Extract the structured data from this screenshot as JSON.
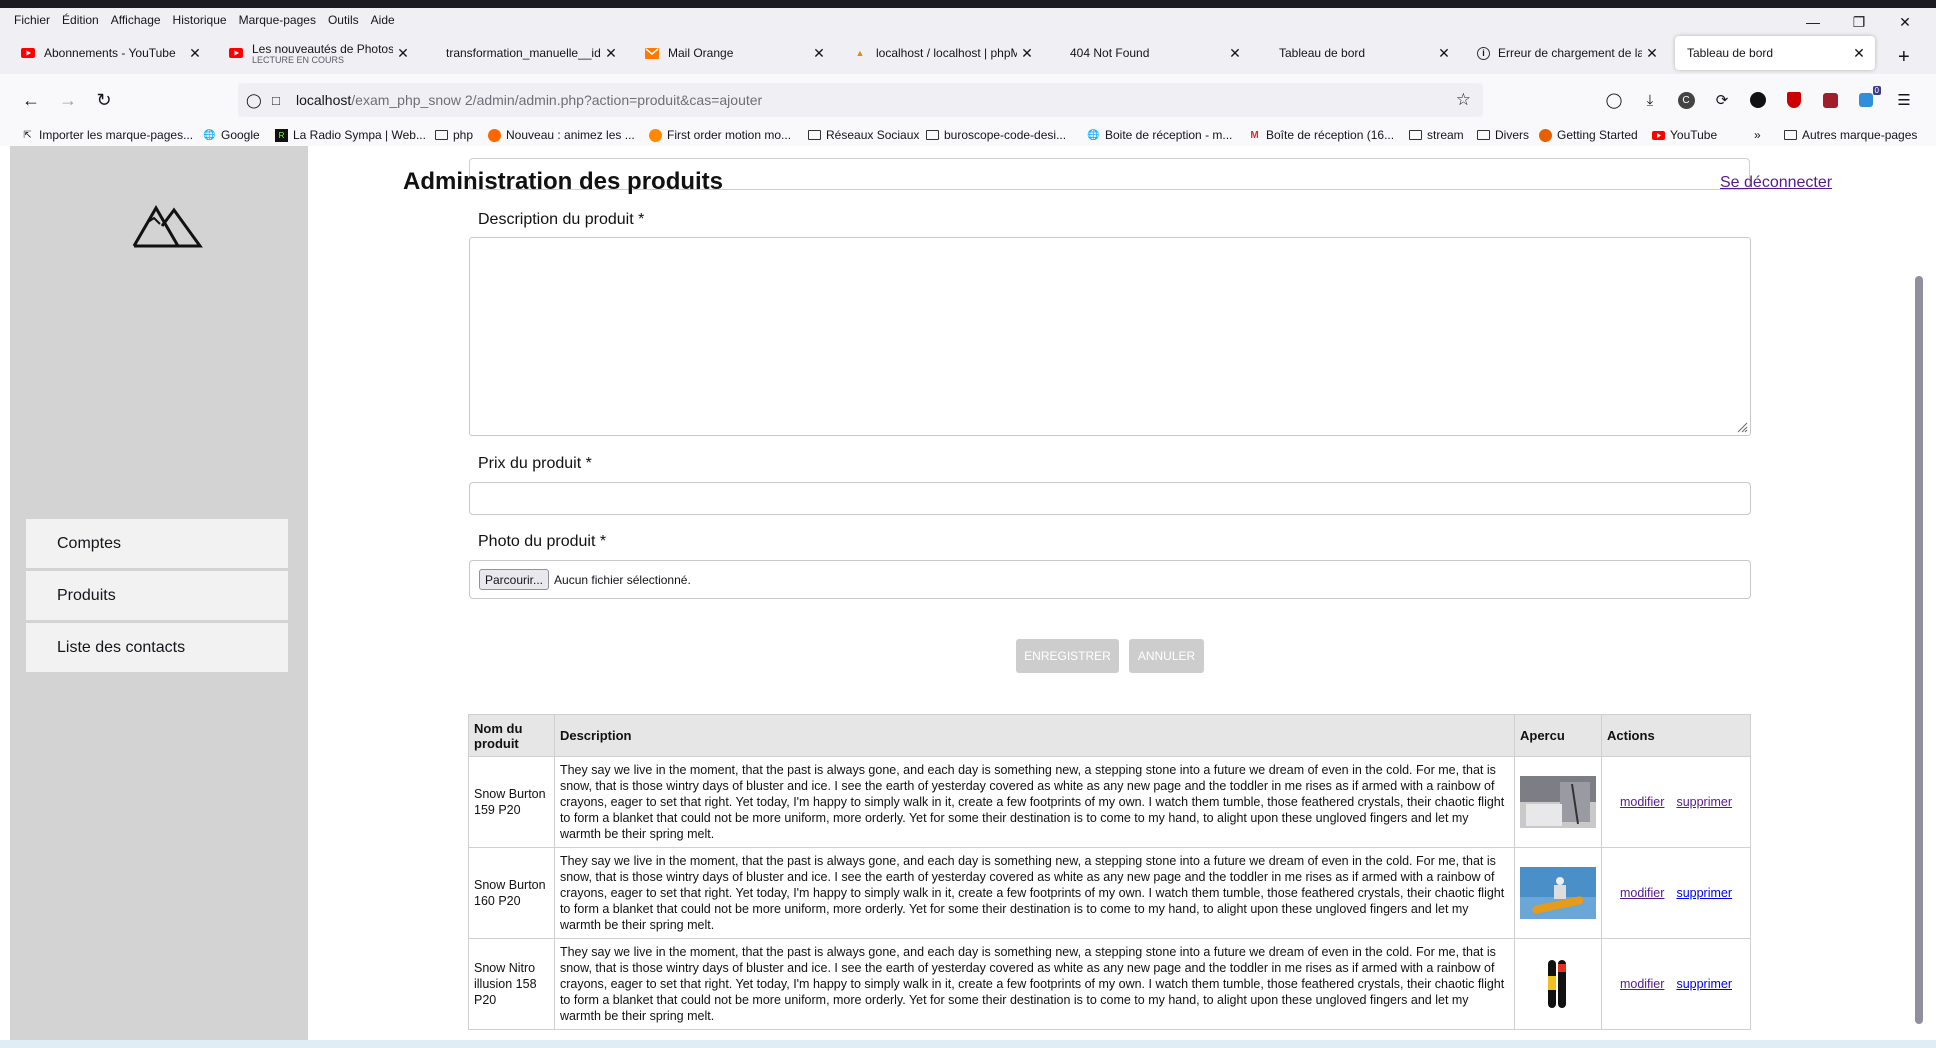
{
  "browser": {
    "menu": [
      "Fichier",
      "Édition",
      "Affichage",
      "Historique",
      "Marque-pages",
      "Outils",
      "Aide"
    ],
    "tabs": [
      {
        "title": "Abonnements - YouTube",
        "icon": "youtube-icon",
        "color": "#ff0000"
      },
      {
        "title": "Les nouveautés de Photoshop",
        "subtitle": "LECTURE EN COURS",
        "icon": "youtube-icon",
        "color": "#ff0000"
      },
      {
        "title": "transformation_manuelle__id.png",
        "icon": "none"
      },
      {
        "title": "Mail Orange",
        "icon": "mail-icon",
        "color": "#ff7900"
      },
      {
        "title": "localhost / localhost | phpMyAdmin",
        "icon": "phpmyadmin-icon"
      },
      {
        "title": "404 Not Found",
        "icon": "none"
      },
      {
        "title": "Tableau de bord",
        "icon": "none"
      },
      {
        "title": "Erreur de chargement de la page",
        "icon": "info-icon"
      },
      {
        "title": "Tableau de bord",
        "icon": "none",
        "active": true
      }
    ],
    "url": {
      "host": "localhost",
      "path": "/exam_php_snow 2/admin/admin.php?action=produit&cas=ajouter"
    },
    "bookmarks": [
      {
        "label": "Importer les marque-pages...",
        "icon": "import-icon"
      },
      {
        "label": "Google",
        "icon": "globe-icon"
      },
      {
        "label": "La Radio Sympa | Web...",
        "icon": "radio-icon"
      },
      {
        "label": "php",
        "icon": "folder-icon"
      },
      {
        "label": "Nouveau : animez les ...",
        "icon": "orange-icon"
      },
      {
        "label": "First order motion mo...",
        "icon": "orange-icon"
      },
      {
        "label": "Réseaux Sociaux",
        "icon": "folder-icon"
      },
      {
        "label": "buroscope-code-desi...",
        "icon": "folder-icon"
      },
      {
        "label": "Boite de réception - m...",
        "icon": "globe-icon"
      },
      {
        "label": "Boîte de réception (16...",
        "icon": "gmail-icon"
      },
      {
        "label": "stream",
        "icon": "folder-icon"
      },
      {
        "label": "Divers",
        "icon": "folder-icon"
      },
      {
        "label": "Getting Started",
        "icon": "firefox-icon"
      },
      {
        "label": "YouTube",
        "icon": "youtube-icon"
      },
      {
        "label": "Autres marque-pages",
        "icon": "folder-icon"
      }
    ],
    "ext_badge": "0"
  },
  "sidebar": {
    "items": [
      {
        "label": "Comptes"
      },
      {
        "label": "Produits"
      },
      {
        "label": "Liste des contacts"
      }
    ]
  },
  "main": {
    "title": "Administration des produits",
    "logout": "Se déconnecter",
    "form": {
      "description_label": "Description du produit *",
      "price_label": "Prix du produit *",
      "photo_label": "Photo du produit *",
      "file_button": "Parcourir...",
      "file_status": "Aucun fichier sélectionné.",
      "save_button": "ENREGISTRER",
      "cancel_button": "ANNULER"
    },
    "table": {
      "headers": [
        "Nom du produit",
        "Description",
        "Apercu",
        "Actions"
      ],
      "rows": [
        {
          "name": "Snow Burton 159 P20",
          "description": "They say we live in the moment, that the past is always gone, and each day is something new, a stepping stone into a future we dream of even in the cold. For me, that is snow, that is those wintry days of bluster and ice. I see the earth of yesterday covered as white as any new page and the toddler in me rises as if armed with a rainbow of crayons, eager to set that right. Yet today, I'm happy to simply walk in it, create a few footprints of my own. I watch them tumble, those feathered crystals, their chaotic flight to form a blanket that could not be more uniform, more orderly. Yet for some their destination is to come to my hand, to alight upon these ungloved fingers and let my warmth be their spring melt.",
          "modify": "modifier",
          "delete": "supprimer",
          "thumb": "snow-photo"
        },
        {
          "name": "Snow Burton 160 P20",
          "description": "They say we live in the moment, that the past is always gone, and each day is something new, a stepping stone into a future we dream of even in the cold. For me, that is snow, that is those wintry days of bluster and ice. I see the earth of yesterday covered as white as any new page and the toddler in me rises as if armed with a rainbow of crayons, eager to set that right. Yet today, I'm happy to simply walk in it, create a few footprints of my own. I watch them tumble, those feathered crystals, their chaotic flight to form a blanket that could not be more uniform, more orderly. Yet for some their destination is to come to my hand, to alight upon these ungloved fingers and let my warmth be their spring melt.",
          "modify": "modifier",
          "delete": "supprimer",
          "thumb": "snowboarder-photo"
        },
        {
          "name": "Snow Nitro illusion 158 P20",
          "description": "They say we live in the moment, that the past is always gone, and each day is something new, a stepping stone into a future we dream of even in the cold. For me, that is snow, that is those wintry days of bluster and ice. I see the earth of yesterday covered as white as any new page and the toddler in me rises as if armed with a rainbow of crayons, eager to set that right. Yet today, I'm happy to simply walk in it, create a few footprints of my own. I watch them tumble, those feathered crystals, their chaotic flight to form a blanket that could not be more uniform, more orderly. Yet for some their destination is to come to my hand, to alight upon these ungloved fingers and let my warmth be their spring melt.",
          "modify": "modifier",
          "delete": "supprimer",
          "thumb": "board-photo"
        }
      ]
    }
  },
  "colors": {
    "link_visited": "#551a8b",
    "link": "#0000ee",
    "sidebar_bg": "#d3d3d3",
    "button_disabled": "#cdcdcd"
  }
}
